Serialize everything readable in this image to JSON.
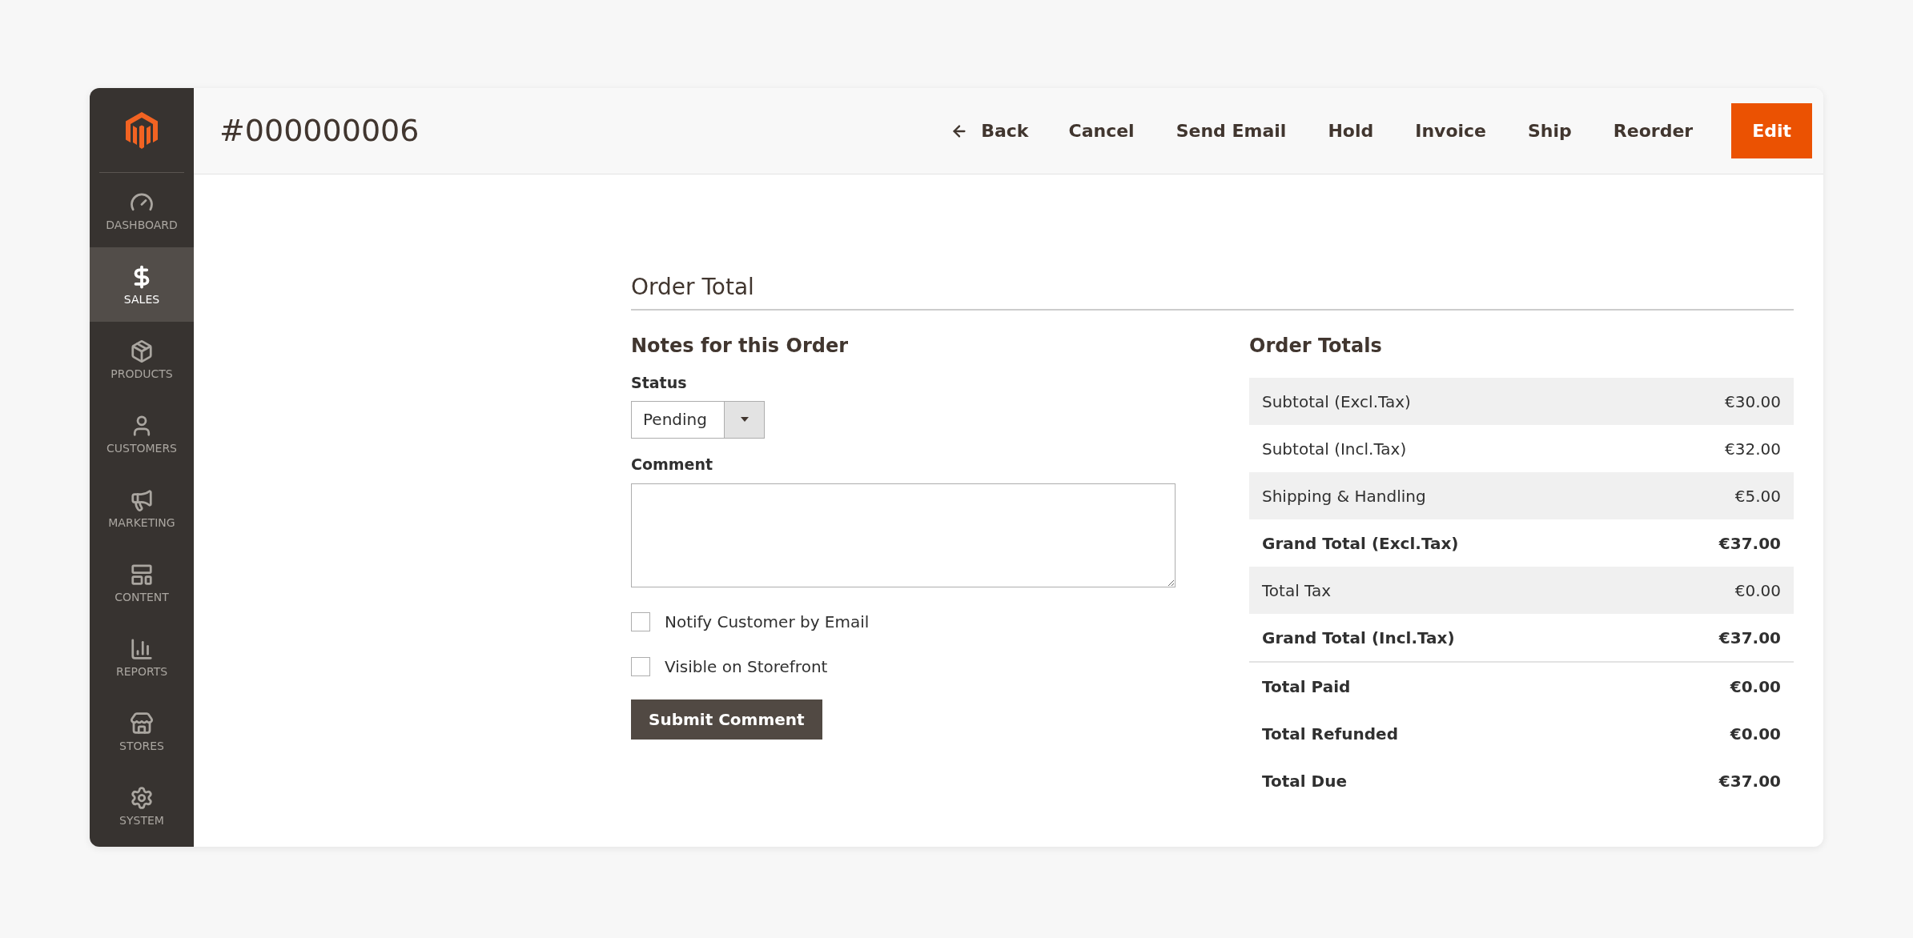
{
  "sidebar": {
    "items": [
      {
        "label": "DASHBOARD",
        "kind": "dashboard",
        "selected": false
      },
      {
        "label": "SALES",
        "kind": "sales",
        "selected": true
      },
      {
        "label": "PRODUCTS",
        "kind": "products",
        "selected": false
      },
      {
        "label": "CUSTOMERS",
        "kind": "customers",
        "selected": false
      },
      {
        "label": "MARKETING",
        "kind": "marketing",
        "selected": false
      },
      {
        "label": "CONTENT",
        "kind": "content",
        "selected": false
      },
      {
        "label": "REPORTS",
        "kind": "reports",
        "selected": false
      },
      {
        "label": "STORES",
        "kind": "stores",
        "selected": false
      },
      {
        "label": "SYSTEM",
        "kind": "system",
        "selected": false
      }
    ]
  },
  "header": {
    "title": "#000000006",
    "actions": [
      {
        "label": "Back",
        "kind": "back"
      },
      {
        "label": "Cancel",
        "kind": "plain"
      },
      {
        "label": "Send Email",
        "kind": "plain"
      },
      {
        "label": "Hold",
        "kind": "plain"
      },
      {
        "label": "Invoice",
        "kind": "plain"
      },
      {
        "label": "Ship",
        "kind": "plain"
      },
      {
        "label": "Reorder",
        "kind": "plain"
      },
      {
        "label": "Edit",
        "kind": "primary"
      }
    ]
  },
  "section": {
    "title": "Order Total",
    "notes": {
      "title": "Notes for this Order",
      "status_label": "Status",
      "status_value": "Pending",
      "comment_label": "Comment",
      "checkboxes": [
        {
          "label": "Notify Customer by Email",
          "checked": false
        },
        {
          "label": "Visible on Storefront",
          "checked": false
        }
      ],
      "submit": "Submit Comment"
    },
    "totals": {
      "title": "Order Totals",
      "rows": [
        {
          "label": "Subtotal (Excl.Tax)",
          "value": "€30.00",
          "bold": false
        },
        {
          "label": "Subtotal (Incl.Tax)",
          "value": "€32.00",
          "bold": false
        },
        {
          "label": "Shipping & Handling",
          "value": "€5.00",
          "bold": false
        },
        {
          "label": "Grand Total (Excl.Tax)",
          "value": "€37.00",
          "bold": true
        },
        {
          "label": "Total Tax",
          "value": "€0.00",
          "bold": false
        },
        {
          "label": "Grand Total (Incl.Tax)",
          "value": "€37.00",
          "bold": true
        }
      ],
      "summary_rows": [
        {
          "label": "Total Paid",
          "value": "€0.00",
          "bold": true
        },
        {
          "label": "Total Refunded",
          "value": "€0.00",
          "bold": true
        },
        {
          "label": "Total Due",
          "value": "€37.00",
          "bold": true
        }
      ]
    }
  }
}
